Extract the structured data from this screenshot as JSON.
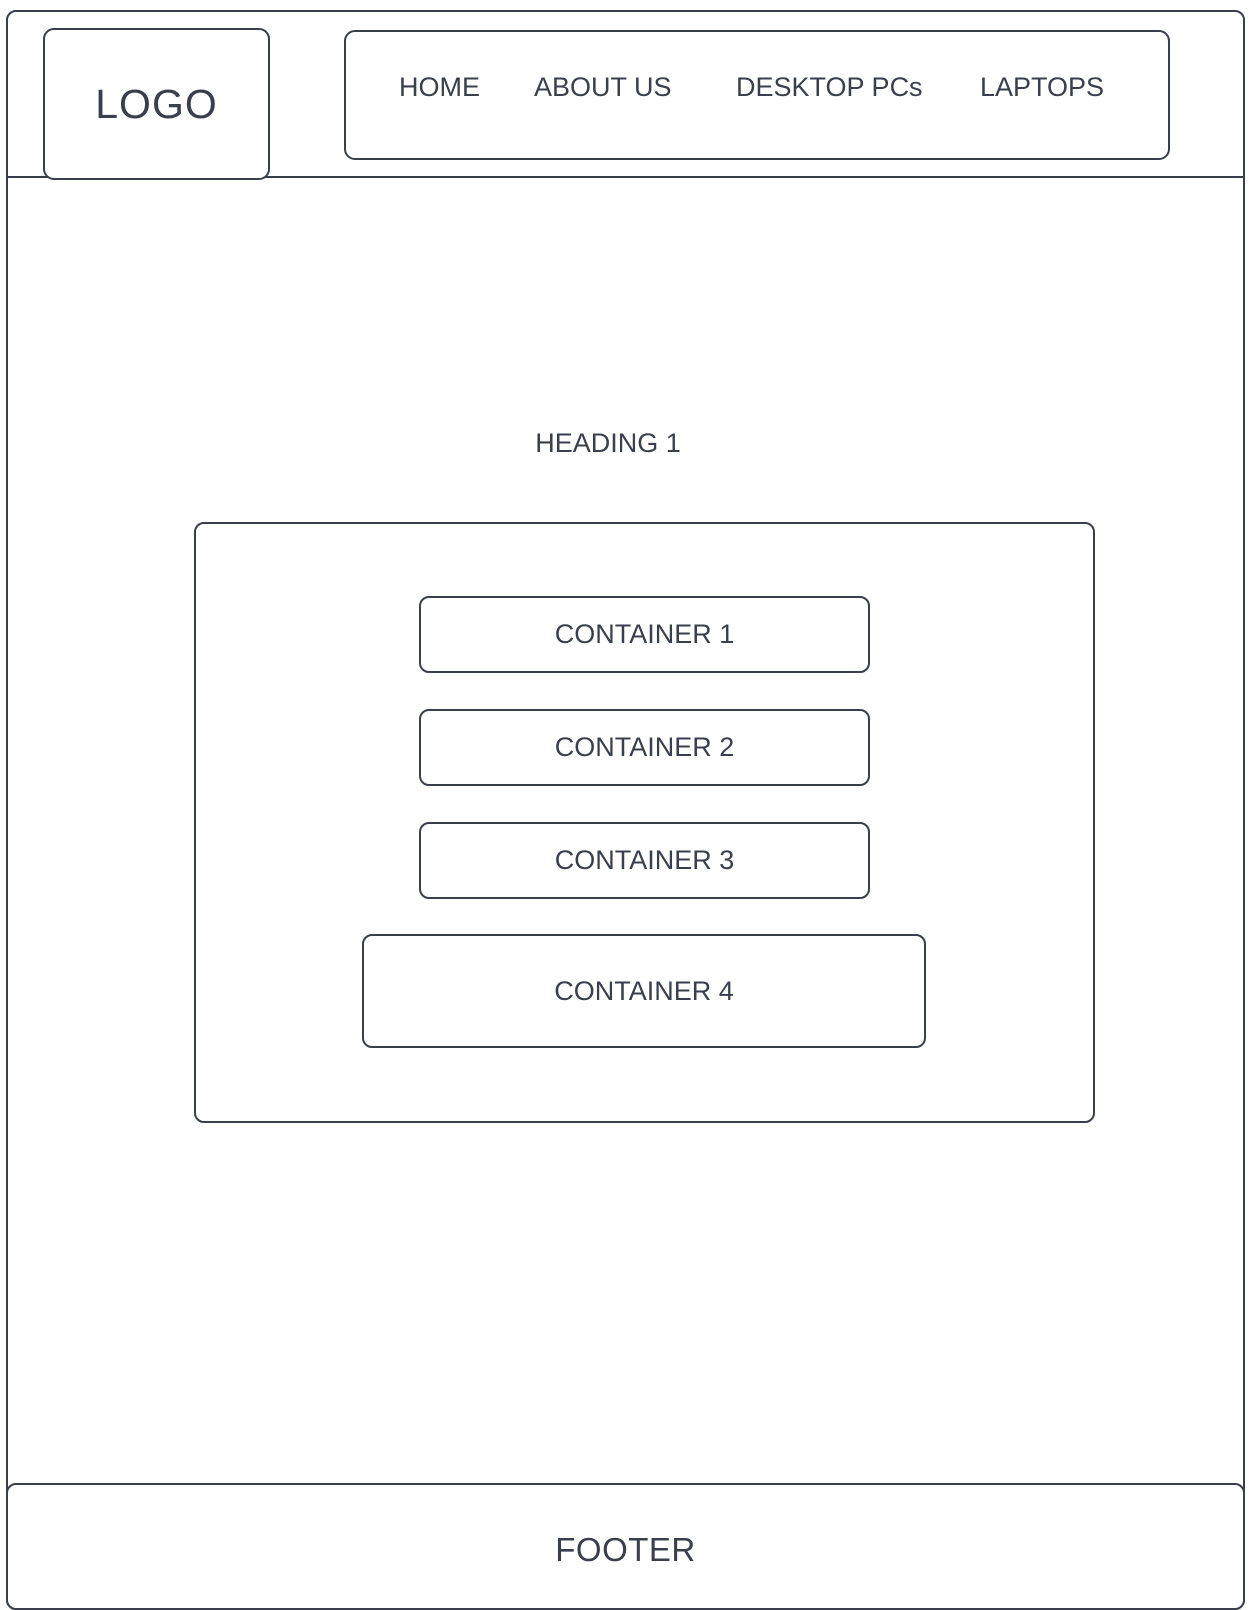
{
  "header": {
    "logo": "LOGO",
    "nav": {
      "items": [
        {
          "label": "HOME"
        },
        {
          "label": "ABOUT US"
        },
        {
          "label": "DESKTOP PCs"
        },
        {
          "label": "LAPTOPS"
        }
      ]
    }
  },
  "main": {
    "heading": "HEADING 1",
    "containers": [
      {
        "label": "CONTAINER 1"
      },
      {
        "label": "CONTAINER 2"
      },
      {
        "label": "CONTAINER 3"
      },
      {
        "label": "CONTAINER 4"
      }
    ]
  },
  "footer": {
    "label": "FOOTER"
  },
  "colors": {
    "stroke": "#3a3f4b",
    "background": "#ffffff"
  }
}
